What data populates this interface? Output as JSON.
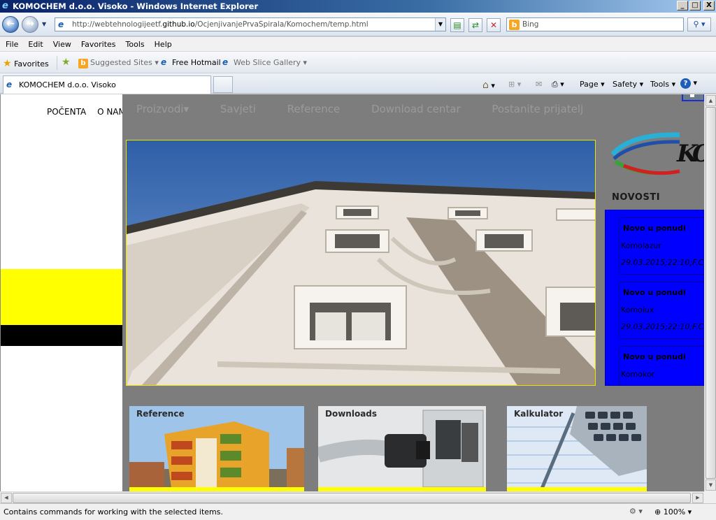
{
  "window": {
    "title": "KOMOCHEM d.o.o. Visoko - Windows Internet Explorer",
    "buttons": {
      "minimize": "_",
      "maximize": "□",
      "close": "X"
    }
  },
  "address_bar": {
    "url_prefix": "http://webtehnologijeetf.",
    "url_domain": "github.io",
    "url_suffix": "/OcjenjivanjePrvaSpirala/Komochem/temp.html",
    "search_placeholder": "Bing"
  },
  "menu": [
    "File",
    "Edit",
    "View",
    "Favorites",
    "Tools",
    "Help"
  ],
  "favorites_bar": {
    "favorites_label": "Favorites",
    "suggested_sites": "Suggested Sites",
    "free_hotmail": "Free Hotmail",
    "web_slice_gallery": "Web Slice Gallery"
  },
  "tabs": [
    {
      "label": "KOMOCHEM d.o.o. Visoko"
    }
  ],
  "command_bar": {
    "page": "Page",
    "safety": "Safety",
    "tools": "Tools"
  },
  "page": {
    "left_nav": [
      "POČENTA",
      "O NAM"
    ],
    "overlay_nav": [
      "Proizvodi▾",
      "Savjeti",
      "Reference",
      "Download centar",
      "Postanite prijatelj"
    ],
    "news_heading": "NOVOSTI",
    "news": [
      {
        "title": "Novo u ponudi",
        "name": "Komolazur",
        "date": "29.03.2015;22:10;F.C"
      },
      {
        "title": "Novo u ponudi",
        "name": "Komolux",
        "date": "29.03.2015;22:10;F.C"
      },
      {
        "title": "Novo u ponudi",
        "name": "Komokor",
        "date": ""
      }
    ],
    "cards": [
      {
        "title": "Reference"
      },
      {
        "title": "Downloads"
      },
      {
        "title": "Kalkulator"
      }
    ],
    "colors": {
      "overlay": "#7d7d7d",
      "news_panel": "#0000ff",
      "accent_yellow": "#ffff00"
    }
  },
  "status_bar": {
    "message": "Contains commands for working with the selected items.",
    "zoom": "100%"
  }
}
